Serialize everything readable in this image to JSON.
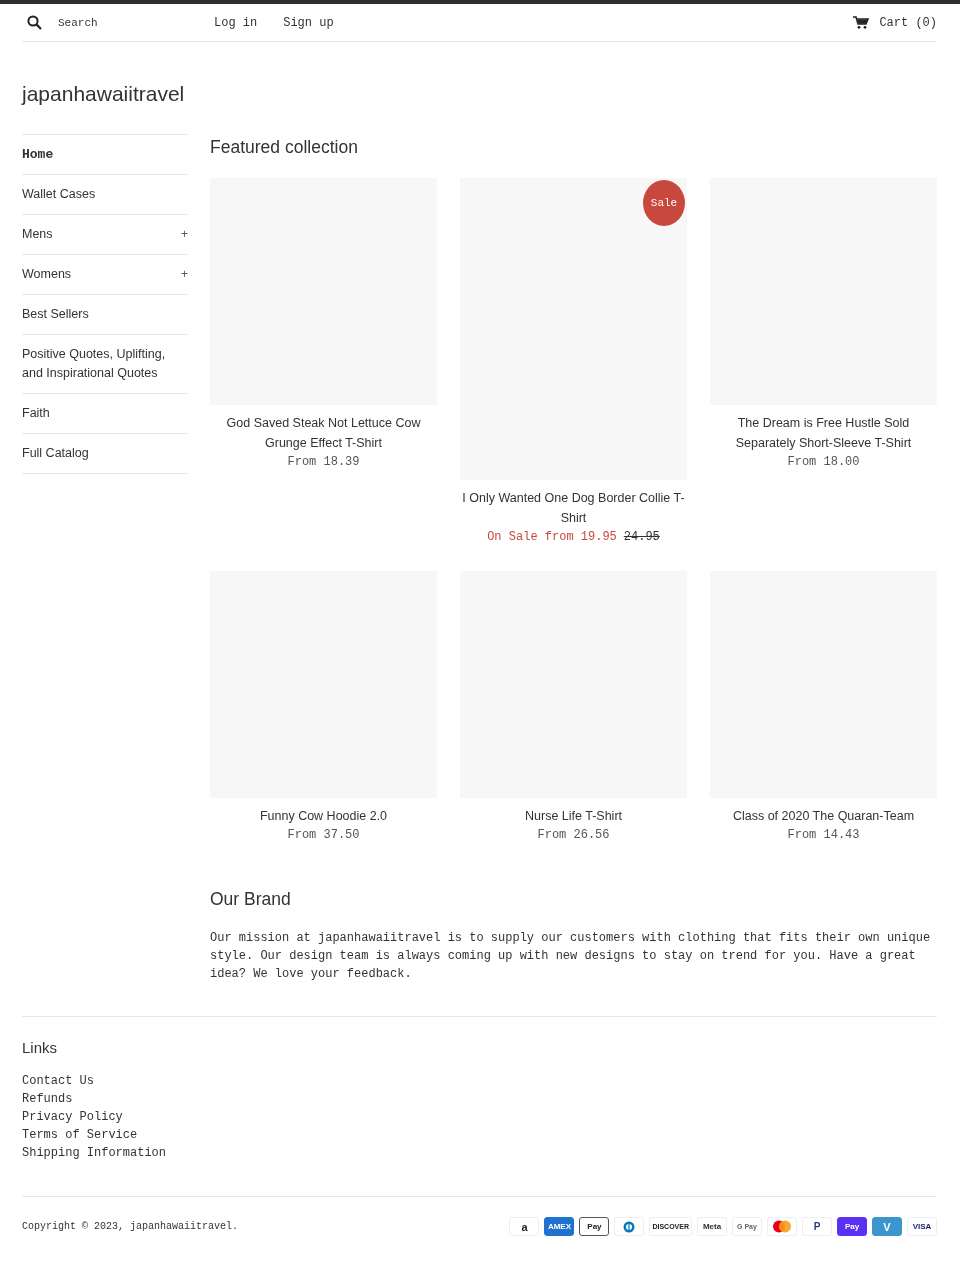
{
  "header": {
    "search": {
      "placeholder": "Search"
    },
    "links": [
      "Log in",
      "Sign up"
    ],
    "cart": "Cart (0)"
  },
  "logo": "japanhawaiitravel",
  "sidebar": {
    "items": [
      {
        "label": "Home",
        "selected": true
      },
      {
        "label": "Wallet Cases",
        "selected": false
      },
      {
        "label": "Mens",
        "selected": false,
        "toggle": "+"
      },
      {
        "label": "Womens",
        "selected": false,
        "toggle": "+"
      },
      {
        "label": "Best Sellers",
        "selected": false
      },
      {
        "label": "Positive Quotes, Uplifting, and Inspirational Quotes",
        "selected": false
      },
      {
        "label": "Faith",
        "selected": false
      },
      {
        "label": "Full Catalog",
        "selected": false
      }
    ]
  },
  "featured": {
    "title": "Featured collection",
    "products": [
      {
        "title": "God Saved Steak Not Lettuce Cow Grunge Effect T-Shirt",
        "kind": "square",
        "on_sale": false,
        "price": "From 18.39"
      },
      {
        "title": "I Only Wanted One Dog Border Collie T-Shirt",
        "kind": "portrait",
        "on_sale": true,
        "badge": "Sale",
        "price": "On Sale from 19.95",
        "compare_price": "24.95"
      },
      {
        "title": "The Dream is Free Hustle Sold Separately Short-Sleeve T-Shirt",
        "kind": "square",
        "on_sale": false,
        "price": "From 18.00"
      },
      {
        "title": "Funny Cow Hoodie 2.0",
        "kind": "square",
        "on_sale": false,
        "price": "From 37.50"
      },
      {
        "title": "Nurse Life T-Shirt",
        "kind": "square",
        "on_sale": false,
        "price": "From 26.56"
      },
      {
        "title": "Class of 2020 The Quaran-Team",
        "kind": "square",
        "on_sale": false,
        "price": "From 14.43"
      }
    ]
  },
  "brand": {
    "title": "Our Brand",
    "text": "Our mission at japanhawaiitravel is to supply our customers with clothing that fits their own unique style. Our design team is always coming up with new designs to stay on trend for you. Have a great idea? We love your feedback."
  },
  "footer": {
    "links_title": "Links",
    "links": [
      "Contact Us",
      "Refunds",
      "Privacy Policy",
      "Terms of Service",
      "Shipping Information"
    ],
    "copyright": "Copyright © 2023, japanhawaiitravel.",
    "payment_icons": [
      {
        "kind": "amazon",
        "label": "a"
      },
      {
        "kind": "amex",
        "label": "AMEX"
      },
      {
        "kind": "applepay",
        "label": "Pay"
      },
      {
        "kind": "diners"
      },
      {
        "kind": "discover",
        "label": "DISCOVER"
      },
      {
        "kind": "meta",
        "label": "Meta"
      },
      {
        "kind": "gpay",
        "label": "G Pay"
      },
      {
        "kind": "mastercard"
      },
      {
        "kind": "paypal",
        "label": "P"
      },
      {
        "kind": "shoppay",
        "label": "Pay"
      },
      {
        "kind": "venmo",
        "label": "V"
      },
      {
        "kind": "visa",
        "label": "VISA"
      }
    ]
  }
}
